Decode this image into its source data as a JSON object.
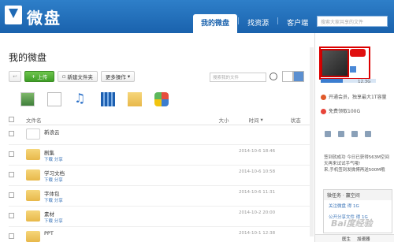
{
  "app": {
    "logo_text": "微盘"
  },
  "nav": {
    "items": [
      "我的微盘",
      "找资源",
      "客户端"
    ],
    "active": 0
  },
  "top_search": {
    "placeholder": "搜索大家共享的文件"
  },
  "main": {
    "title": "我的微盘"
  },
  "toolbar": {
    "upload": "上传",
    "new_folder": "新建文件夹",
    "more_ops": "更多操作",
    "search_placeholder": "搜索我的文件"
  },
  "columns": {
    "name": "文件名",
    "size": "大小",
    "time": "时间",
    "status": "状态"
  },
  "files": [
    {
      "name": "新浪云",
      "date": "",
      "actions": "",
      "type": "cloud"
    },
    {
      "name": "剧集",
      "date": "2014-10-6 18:46",
      "actions": "下载 分享",
      "type": "folder"
    },
    {
      "name": "学习文档",
      "date": "2014-10-6 10:58",
      "actions": "下载 分享",
      "type": "folder"
    },
    {
      "name": "字体包",
      "date": "2014-10-6 11:31",
      "actions": "下载 分享",
      "type": "folder"
    },
    {
      "name": "素材",
      "date": "2014-10-2 20:00",
      "actions": "下载 分享",
      "type": "folder"
    },
    {
      "name": "PPT",
      "date": "2014-10-1 12:38",
      "actions": "",
      "type": "folder"
    }
  ],
  "sidebar": {
    "quota": "12.3G",
    "quota_fraction": 0.4,
    "links": [
      "开通会员，独享最大1T容量",
      "免费领取100G"
    ],
    "checkin": "签到就成功 今日已获得563M空间",
    "checkin2": "天再来试试手气哦!",
    "checkin3": "来,手机签到发微博再送500M哦",
    "weibo_title": "微任务 · 赢空间",
    "weibo_items": [
      "关注微盘 得 1G",
      "公开分享文件 得 1G"
    ]
  },
  "watermark": "Bai度经验",
  "footer": {
    "items": [
      "医生",
      "加速器"
    ]
  },
  "colors": {
    "topbar": "#1f6ab5",
    "accent_red": "#d00000",
    "upload_green": "#4caf32"
  }
}
